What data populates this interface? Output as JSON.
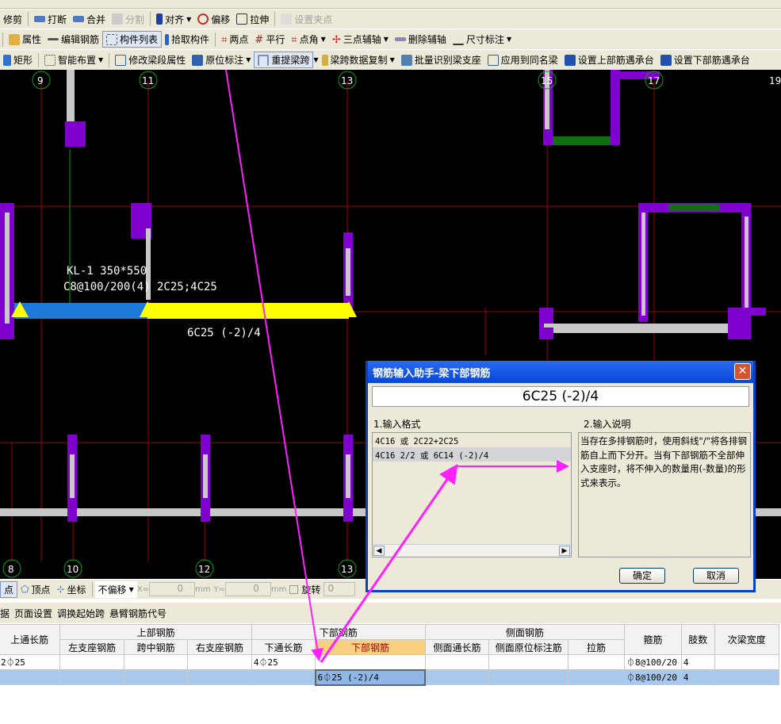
{
  "toolbar_row1": {
    "items": [
      "修剪",
      "打断",
      "合并",
      "分割",
      "对齐",
      "偏移",
      "拉伸",
      "设置夹点"
    ]
  },
  "toolbar_row2": {
    "items": [
      "属性",
      "编辑钢筋",
      "构件列表",
      "拾取构件",
      "两点",
      "平行",
      "点角",
      "三点辅轴",
      "删除辅轴",
      "尺寸标注"
    ]
  },
  "toolbar_row3": {
    "items": [
      "矩形",
      "智能布置",
      "修改梁段属性",
      "原位标注",
      "重提梁跨",
      "梁跨数据复制",
      "批量识别梁支座",
      "应用到同名梁",
      "设置上部筋遇承台",
      "设置下部筋遇承台"
    ]
  },
  "canvas": {
    "axes_top": [
      "9",
      "11",
      "13",
      "15",
      "17",
      "19"
    ],
    "axes_bottom": [
      "8",
      "10",
      "12",
      "13"
    ],
    "beam_label": "KL-1 350*550",
    "beam_stirrup": "C8@100/200(4) 2C25;4C25",
    "beam_span_label": "6C25 (-2)/4"
  },
  "dialog": {
    "title": "钢筋输入助手-梁下部钢筋",
    "value": "6C25 (-2)/4",
    "format_label": "1.输入格式",
    "formats": [
      "4C16 或 2C22+2C25",
      "4C16 2/2 或 6C14 (-2)/4"
    ],
    "desc_label": "2.输入说明",
    "description": "当存在多排钢筋时，使用斜线\"/\"将各排钢筋自上而下分开。当有下部钢筋不全部伸入支座时，将不伸入的数量用(-数量)的形式来表示。",
    "ok": "确定",
    "cancel": "取消"
  },
  "snapbar": {
    "items": [
      "点",
      "顶点",
      "坐标"
    ],
    "offset": "不偏移",
    "x_label": "X=",
    "x_val": "0",
    "y_label": "Y=",
    "y_val": "0",
    "unit": "mm",
    "rotate": "旋转",
    "rotate_val": "0"
  },
  "menu": {
    "items": [
      "据",
      "页面设置",
      "调换起始跨",
      "悬臂钢筋代号"
    ]
  },
  "table": {
    "groups": [
      "上通长筋",
      "上部钢筋",
      "下部钢筋",
      "侧面钢筋",
      "箍筋",
      "肢数",
      "次梁宽度"
    ],
    "columns": [
      "左支座钢筋",
      "跨中钢筋",
      "右支座钢筋",
      "下通长筋",
      "下部钢筋",
      "侧面通长筋",
      "侧面原位标注筋",
      "拉筋"
    ],
    "rows": [
      [
        "2⏀25",
        "",
        "",
        "",
        "4⏀25",
        "",
        "",
        "",
        "",
        "⏀8@100/20",
        "4",
        ""
      ],
      [
        "",
        "",
        "",
        "",
        "",
        "6⏀25 (-2)/4",
        "",
        "",
        "",
        "⏀8@100/20",
        "4",
        ""
      ]
    ]
  }
}
